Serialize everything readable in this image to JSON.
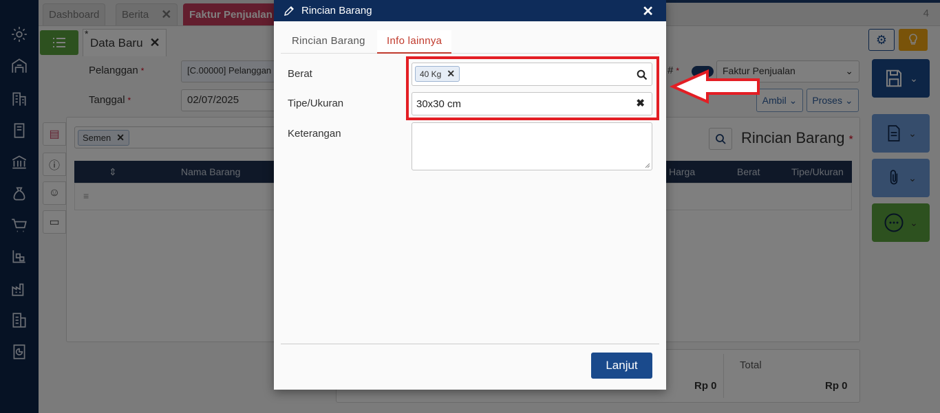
{
  "tabs": [
    {
      "label": "Dashboard"
    },
    {
      "label": "Berita"
    },
    {
      "label": "Faktur Penjualan"
    }
  ],
  "tab_count": "4",
  "doc_tab": {
    "marker": "*",
    "label": "Data Baru"
  },
  "form": {
    "pelanggan_label": "Pelanggan",
    "pelanggan_value": "[C.00000] Pelanggan",
    "tanggal_label": "Tanggal",
    "tanggal_value": "02/07/2025",
    "required_mark": "*",
    "hash_label": "#",
    "doc_type_value": "Faktur Penjualan",
    "ambil_label": "Ambil",
    "proses_label": "Proses"
  },
  "detail_panel": {
    "tag": "Semen",
    "title": "Rincian Barang",
    "title_mark": "*",
    "columns": [
      "Nama Barang",
      "Harga",
      "Berat",
      "Tipe/Ukuran"
    ]
  },
  "totals": {
    "left_value": "Rp 0",
    "total_label": "Total",
    "total_value": "Rp 0"
  },
  "modal": {
    "title": "Rincian Barang",
    "tabs": [
      {
        "label": "Rincian Barang",
        "active": false
      },
      {
        "label": "Info lainnya",
        "active": true
      }
    ],
    "fields": {
      "berat_label": "Berat",
      "berat_chip": "40 Kg",
      "tipe_label": "Tipe/Ukuran",
      "tipe_value": "30x30 cm",
      "keterangan_label": "Keterangan",
      "keterangan_value": ""
    },
    "submit_label": "Lanjut"
  },
  "colors": {
    "sidebar": "#0d2449",
    "modal_header": "#0e2c5a",
    "active_tab": "#c73d5c",
    "highlight": "#e31e24",
    "primary_button": "#1a4a8c"
  }
}
